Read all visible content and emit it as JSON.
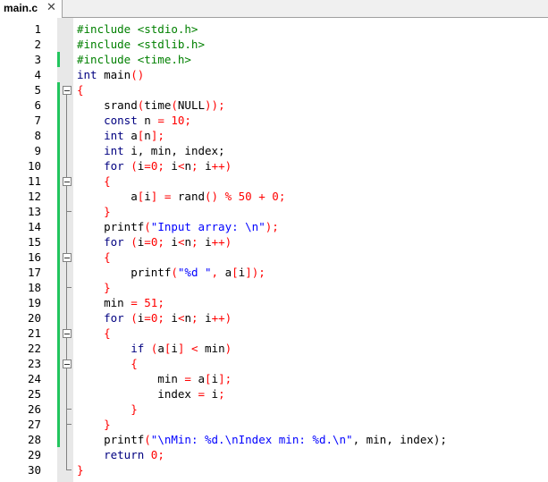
{
  "tab": {
    "title": "main.c",
    "close_glyph": "✕"
  },
  "lines": [
    {
      "n": "1",
      "tokens": [
        {
          "t": "#include <stdio.h>",
          "c": "pre"
        }
      ]
    },
    {
      "n": "2",
      "tokens": [
        {
          "t": "#include <stdlib.h>",
          "c": "pre"
        }
      ]
    },
    {
      "n": "3",
      "tokens": [
        {
          "t": "#include <time.h>",
          "c": "pre"
        }
      ]
    },
    {
      "n": "4",
      "tokens": [
        {
          "t": "int",
          "c": "kw"
        },
        {
          "t": " main",
          "c": "id"
        },
        {
          "t": "()",
          "c": "op"
        }
      ]
    },
    {
      "n": "5",
      "tokens": [
        {
          "t": "{",
          "c": "op"
        }
      ]
    },
    {
      "n": "6",
      "tokens": [
        {
          "t": "    srand",
          "c": "id"
        },
        {
          "t": "(",
          "c": "op"
        },
        {
          "t": "time",
          "c": "id"
        },
        {
          "t": "(",
          "c": "op"
        },
        {
          "t": "NULL",
          "c": "id"
        },
        {
          "t": "));",
          "c": "op"
        }
      ]
    },
    {
      "n": "7",
      "tokens": [
        {
          "t": "    const",
          "c": "kw"
        },
        {
          "t": " n ",
          "c": "id"
        },
        {
          "t": "=",
          "c": "op"
        },
        {
          "t": " 10",
          "c": "num"
        },
        {
          "t": ";",
          "c": "op"
        }
      ]
    },
    {
      "n": "8",
      "tokens": [
        {
          "t": "    int",
          "c": "kw"
        },
        {
          "t": " a",
          "c": "id"
        },
        {
          "t": "[",
          "c": "op"
        },
        {
          "t": "n",
          "c": "id"
        },
        {
          "t": "];",
          "c": "op"
        }
      ]
    },
    {
      "n": "9",
      "tokens": [
        {
          "t": "    int",
          "c": "kw"
        },
        {
          "t": " i, min, index;",
          "c": "id"
        }
      ]
    },
    {
      "n": "10",
      "tokens": [
        {
          "t": "    for",
          "c": "kw"
        },
        {
          "t": " (",
          "c": "op"
        },
        {
          "t": "i",
          "c": "id"
        },
        {
          "t": "=",
          "c": "op"
        },
        {
          "t": "0",
          "c": "num"
        },
        {
          "t": "; ",
          "c": "op"
        },
        {
          "t": "i",
          "c": "id"
        },
        {
          "t": "<",
          "c": "op"
        },
        {
          "t": "n",
          "c": "id"
        },
        {
          "t": "; ",
          "c": "op"
        },
        {
          "t": "i",
          "c": "id"
        },
        {
          "t": "++)",
          "c": "op"
        }
      ]
    },
    {
      "n": "11",
      "tokens": [
        {
          "t": "    {",
          "c": "op"
        }
      ]
    },
    {
      "n": "12",
      "tokens": [
        {
          "t": "        a",
          "c": "id"
        },
        {
          "t": "[",
          "c": "op"
        },
        {
          "t": "i",
          "c": "id"
        },
        {
          "t": "] = ",
          "c": "op"
        },
        {
          "t": "rand",
          "c": "id"
        },
        {
          "t": "() % ",
          "c": "op"
        },
        {
          "t": "50",
          "c": "num"
        },
        {
          "t": " + ",
          "c": "op"
        },
        {
          "t": "0",
          "c": "num"
        },
        {
          "t": ";",
          "c": "op"
        }
      ]
    },
    {
      "n": "13",
      "tokens": [
        {
          "t": "    }",
          "c": "op"
        }
      ]
    },
    {
      "n": "14",
      "tokens": [
        {
          "t": "    printf",
          "c": "id"
        },
        {
          "t": "(",
          "c": "op"
        },
        {
          "t": "\"Input array: \\n\"",
          "c": "str"
        },
        {
          "t": ");",
          "c": "op"
        }
      ]
    },
    {
      "n": "15",
      "tokens": [
        {
          "t": "    for",
          "c": "kw"
        },
        {
          "t": " (",
          "c": "op"
        },
        {
          "t": "i",
          "c": "id"
        },
        {
          "t": "=",
          "c": "op"
        },
        {
          "t": "0",
          "c": "num"
        },
        {
          "t": "; ",
          "c": "op"
        },
        {
          "t": "i",
          "c": "id"
        },
        {
          "t": "<",
          "c": "op"
        },
        {
          "t": "n",
          "c": "id"
        },
        {
          "t": "; ",
          "c": "op"
        },
        {
          "t": "i",
          "c": "id"
        },
        {
          "t": "++)",
          "c": "op"
        }
      ]
    },
    {
      "n": "16",
      "tokens": [
        {
          "t": "    {",
          "c": "op"
        }
      ]
    },
    {
      "n": "17",
      "tokens": [
        {
          "t": "        printf",
          "c": "id"
        },
        {
          "t": "(",
          "c": "op"
        },
        {
          "t": "\"%d \"",
          "c": "str"
        },
        {
          "t": ", ",
          "c": "op"
        },
        {
          "t": "a",
          "c": "id"
        },
        {
          "t": "[",
          "c": "op"
        },
        {
          "t": "i",
          "c": "id"
        },
        {
          "t": "]);",
          "c": "op"
        }
      ]
    },
    {
      "n": "18",
      "tokens": [
        {
          "t": "    }",
          "c": "op"
        }
      ]
    },
    {
      "n": "19",
      "tokens": [
        {
          "t": "    min ",
          "c": "id"
        },
        {
          "t": "=",
          "c": "op"
        },
        {
          "t": " 51",
          "c": "num"
        },
        {
          "t": ";",
          "c": "op"
        }
      ]
    },
    {
      "n": "20",
      "tokens": [
        {
          "t": "    for",
          "c": "kw"
        },
        {
          "t": " (",
          "c": "op"
        },
        {
          "t": "i",
          "c": "id"
        },
        {
          "t": "=",
          "c": "op"
        },
        {
          "t": "0",
          "c": "num"
        },
        {
          "t": "; ",
          "c": "op"
        },
        {
          "t": "i",
          "c": "id"
        },
        {
          "t": "<",
          "c": "op"
        },
        {
          "t": "n",
          "c": "id"
        },
        {
          "t": "; ",
          "c": "op"
        },
        {
          "t": "i",
          "c": "id"
        },
        {
          "t": "++)",
          "c": "op"
        }
      ]
    },
    {
      "n": "21",
      "tokens": [
        {
          "t": "    {",
          "c": "op"
        }
      ]
    },
    {
      "n": "22",
      "tokens": [
        {
          "t": "        if",
          "c": "kw"
        },
        {
          "t": " (",
          "c": "op"
        },
        {
          "t": "a",
          "c": "id"
        },
        {
          "t": "[",
          "c": "op"
        },
        {
          "t": "i",
          "c": "id"
        },
        {
          "t": "] < ",
          "c": "op"
        },
        {
          "t": "min",
          "c": "id"
        },
        {
          "t": ")",
          "c": "op"
        }
      ]
    },
    {
      "n": "23",
      "tokens": [
        {
          "t": "        {",
          "c": "op"
        }
      ]
    },
    {
      "n": "24",
      "tokens": [
        {
          "t": "            min ",
          "c": "id"
        },
        {
          "t": "=",
          "c": "op"
        },
        {
          "t": " a",
          "c": "id"
        },
        {
          "t": "[",
          "c": "op"
        },
        {
          "t": "i",
          "c": "id"
        },
        {
          "t": "];",
          "c": "op"
        }
      ]
    },
    {
      "n": "25",
      "tokens": [
        {
          "t": "            index ",
          "c": "id"
        },
        {
          "t": "=",
          "c": "op"
        },
        {
          "t": " i",
          "c": "id"
        },
        {
          "t": ";",
          "c": "op"
        }
      ]
    },
    {
      "n": "26",
      "tokens": [
        {
          "t": "        }",
          "c": "op"
        }
      ]
    },
    {
      "n": "27",
      "tokens": [
        {
          "t": "    }",
          "c": "op"
        }
      ]
    },
    {
      "n": "28",
      "tokens": [
        {
          "t": "    printf",
          "c": "id"
        },
        {
          "t": "(",
          "c": "op"
        },
        {
          "t": "\"\\nMin: %d.\\nIndex min: %d.\\n\"",
          "c": "str"
        },
        {
          "t": ", min, index);",
          "c": "id"
        }
      ]
    },
    {
      "n": "29",
      "tokens": [
        {
          "t": "    return",
          "c": "kw"
        },
        {
          "t": " 0",
          "c": "num"
        },
        {
          "t": ";",
          "c": "op"
        }
      ]
    },
    {
      "n": "30",
      "tokens": [
        {
          "t": "}",
          "c": "op"
        }
      ]
    }
  ],
  "fold_markers": {
    "boxes": [
      5,
      11,
      16,
      21,
      23
    ],
    "ends": [
      13,
      18,
      26,
      27,
      30
    ],
    "span_start": 5,
    "span_end": 30
  },
  "changed_lines": [
    3,
    5,
    6,
    7,
    8,
    9,
    10,
    11,
    12,
    13,
    14,
    15,
    16,
    17,
    18,
    19,
    20,
    21,
    22,
    23,
    24,
    25,
    26,
    27,
    28
  ],
  "colors": {
    "preprocessor": "#008000",
    "keyword": "#000080",
    "operator": "#ff0000",
    "string": "#0000ff",
    "number": "#ff0000",
    "identifier": "#000000",
    "change_marker": "#22c55e"
  }
}
